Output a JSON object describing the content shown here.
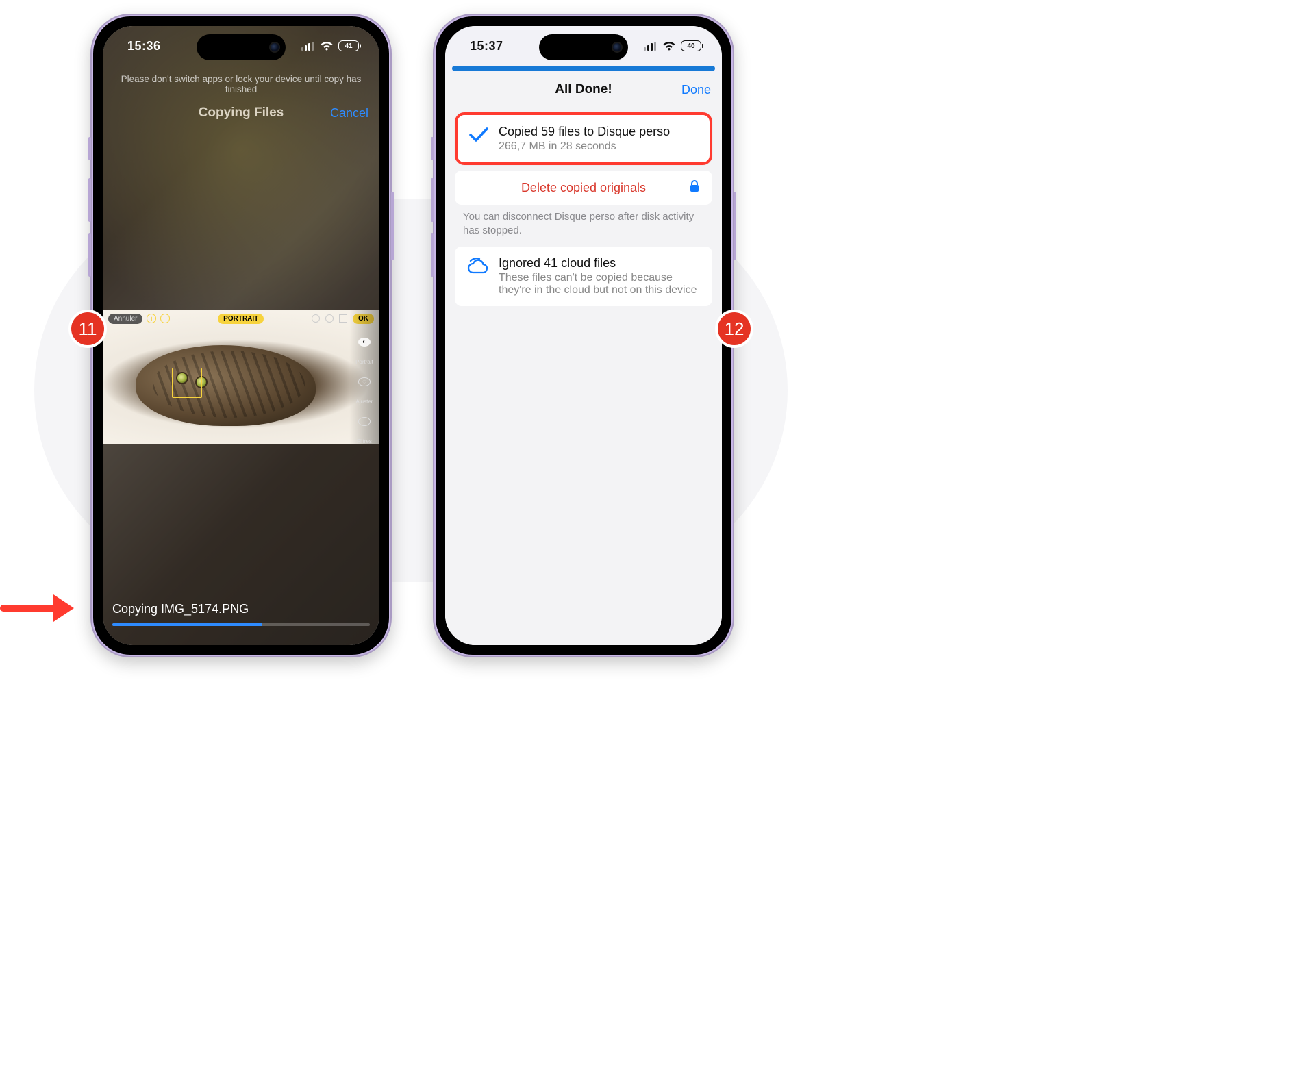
{
  "left": {
    "status_time": "15:36",
    "battery": "41",
    "warning": "Please don't switch apps or lock your device until copy has finished",
    "title": "Copying Files",
    "cancel": "Cancel",
    "preview": {
      "annuler": "Annuler",
      "portrait": "PORTRAIT",
      "ok": "OK",
      "side_portrait": "Portrait",
      "side_adjust": "Ajuster",
      "side_filters": "Filtres"
    },
    "copying_text": "Copying IMG_5174.PNG",
    "progress_pct": 58
  },
  "right": {
    "status_time": "15:37",
    "battery": "40",
    "title": "All Done!",
    "done": "Done",
    "copied_title": "Copied 59 files to Disque perso",
    "copied_sub": "266,7 MB in 28 seconds",
    "delete_label": "Delete copied originals",
    "disconnect_note": "You can disconnect Disque perso after disk activity has stopped.",
    "ignored_title": "Ignored 41 cloud files",
    "ignored_sub": "These files can't be copied because they're in the cloud but not on this device"
  },
  "steps": {
    "left": "11",
    "right": "12"
  }
}
